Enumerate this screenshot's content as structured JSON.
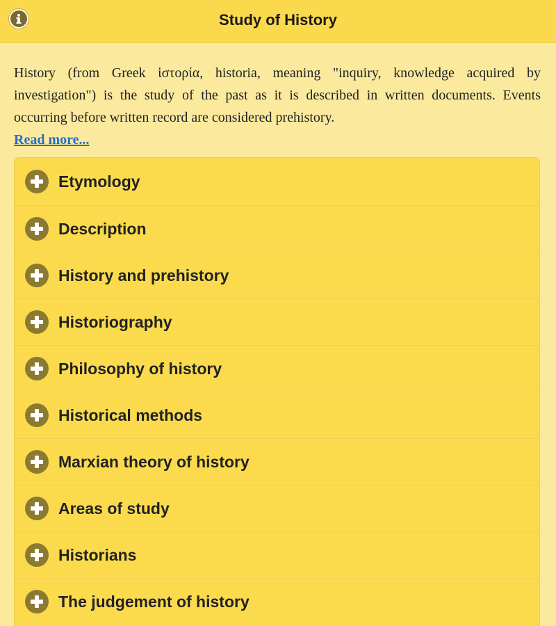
{
  "header": {
    "title": "Study of History",
    "info_icon": "info-icon"
  },
  "intro": {
    "text": "History (from Greek ἱστορία, historia, meaning \"inquiry, knowledge acquired by investigation\") is the study of the past as it is described in written documents. Events occurring before written record are considered prehistory.",
    "read_more": "Read more..."
  },
  "sections": {
    "expand_icon": "plus-circle-icon",
    "items": [
      {
        "label": "Etymology"
      },
      {
        "label": "Description"
      },
      {
        "label": "History and prehistory"
      },
      {
        "label": "Historiography"
      },
      {
        "label": "Philosophy of history"
      },
      {
        "label": "Historical methods"
      },
      {
        "label": "Marxian theory of history"
      },
      {
        "label": "Areas of study"
      },
      {
        "label": "Historians"
      },
      {
        "label": "The judgement of history"
      }
    ]
  },
  "colors": {
    "header_bg": "#fbd94c",
    "page_bg": "#fbea9e",
    "accordion_bg": "#fbdb4d",
    "icon": "#8b7a30",
    "link": "#2b6cc4"
  }
}
